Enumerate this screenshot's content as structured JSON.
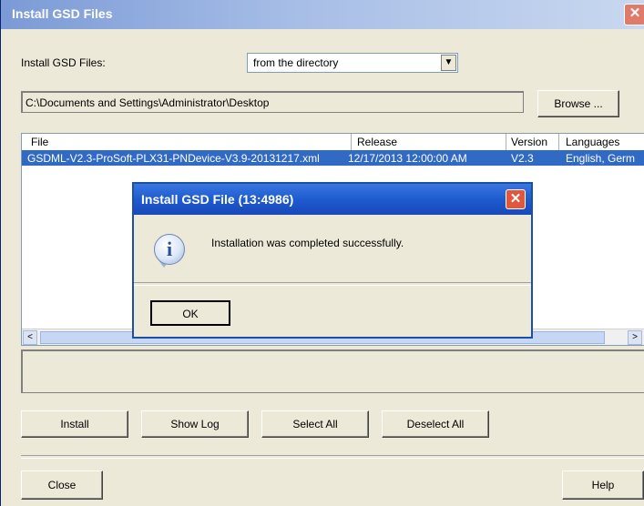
{
  "window": {
    "title": "Install GSD Files",
    "close_glyph": "✕"
  },
  "source": {
    "label": "Install GSD Files:",
    "selected": "from the directory",
    "arrow_glyph": "▼"
  },
  "path": {
    "value": "C:\\Documents and Settings\\Administrator\\Desktop",
    "browse_label": "Browse ..."
  },
  "table": {
    "headers": [
      "File",
      "Release",
      "Version",
      "Languages"
    ],
    "rows": [
      {
        "file": "GSDML-V2.3-ProSoft-PLX31-PNDevice-V3.9-20131217.xml",
        "release": "12/17/2013 12:00:00 AM",
        "version": "V2.3",
        "languages": "English, Germ"
      }
    ],
    "scroll_left_glyph": "<",
    "scroll_right_glyph": ">"
  },
  "actions": {
    "install": "Install",
    "show_log": "Show Log",
    "select_all": "Select All",
    "deselect_all": "Deselect All",
    "close": "Close",
    "help": "Help"
  },
  "dialog": {
    "title": "Install GSD File (13:4986)",
    "close_glyph": "✕",
    "icon_glyph": "i",
    "message": "Installation was completed successfully.",
    "ok": "OK"
  },
  "icons": {
    "info": "info-icon",
    "close": "close-icon",
    "dropdown": "chevron-down-icon"
  }
}
